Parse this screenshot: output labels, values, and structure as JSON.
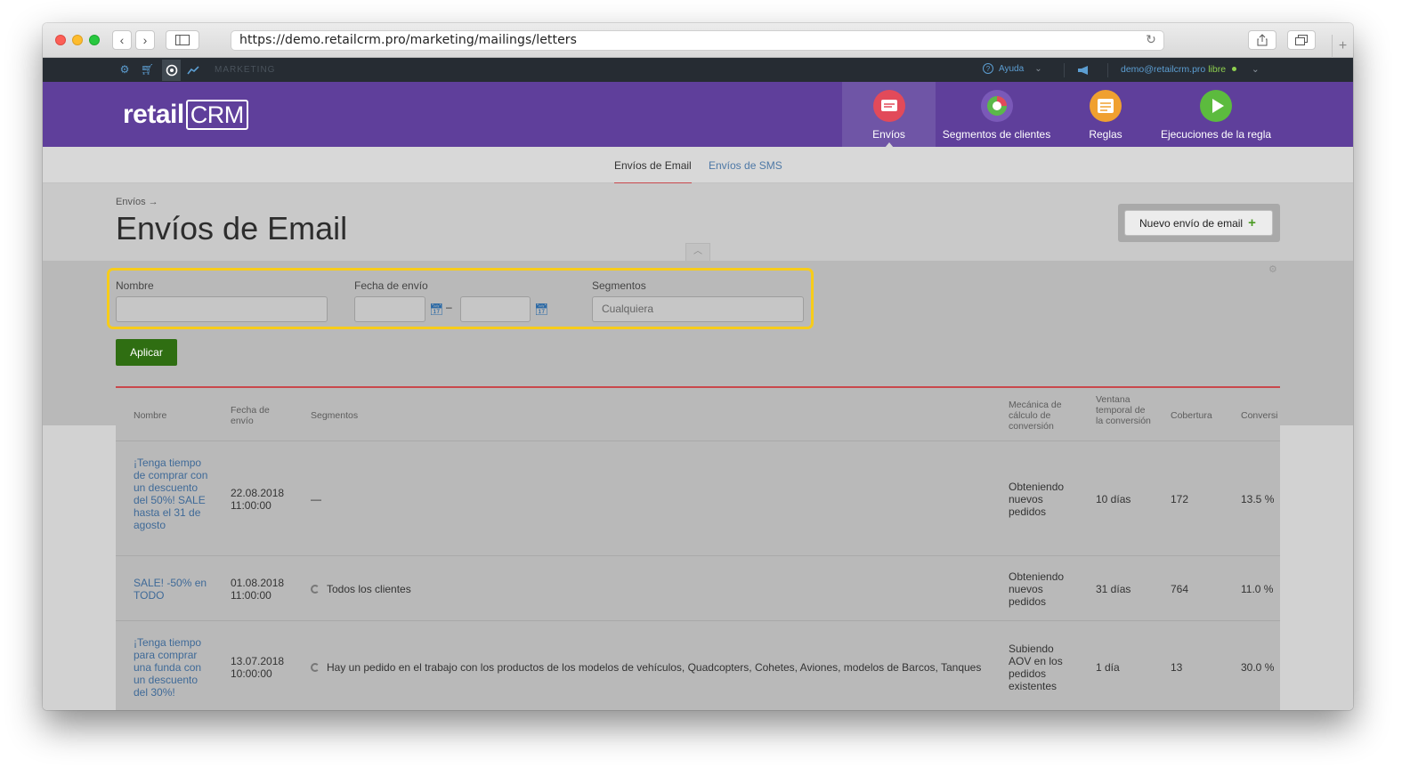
{
  "browser": {
    "url": "https://demo.retailcrm.pro/marketing/mailings/letters",
    "back_icon": "‹",
    "forward_icon": "›",
    "reload_icon": "↻",
    "new_tab": "+"
  },
  "topbar": {
    "section": "MARKETING",
    "help": "Ayuda",
    "user_email": "demo@retailcrm.pro",
    "user_plan": "libre"
  },
  "header": {
    "logo_text": "retail",
    "logo_mark": "CRM",
    "nav": [
      {
        "label": "Envíos",
        "icon": "envelope-icon",
        "color": "#e24a5a"
      },
      {
        "label": "Segmentos de clientes",
        "icon": "segments-icon",
        "color": "#7a59b8"
      },
      {
        "label": "Reglas",
        "icon": "rules-icon",
        "color": "#f0a030"
      },
      {
        "label": "Ejecuciones de la regla",
        "icon": "play-icon",
        "color": "#5cbb3e"
      }
    ]
  },
  "subnav": {
    "email_tab": "Envíos de Email",
    "sms_tab": "Envíos de SMS"
  },
  "page": {
    "breadcrumb": "Envíos →",
    "title": "Envíos de Email",
    "new_button": "Nuevo envío de email",
    "new_button_icon": "+"
  },
  "filters": {
    "name_label": "Nombre",
    "name_value": "",
    "date_label": "Fecha de envío",
    "date_from": "",
    "date_to": "",
    "date_sep": "–",
    "segments_label": "Segmentos",
    "segments_placeholder": "Cualquiera",
    "apply": "Aplicar"
  },
  "table": {
    "headers": {
      "name": "Nombre",
      "date": "Fecha de envío",
      "segments": "Segmentos",
      "mechanic": "Mecánica de cálculo de conversión",
      "window": "Ventana temporal de la conversión",
      "coverage": "Cobertura",
      "conversion": "Conversi"
    },
    "rows": [
      {
        "name": "¡Tenga tiempo de comprar con un descuento del 50%! SALE hasta el 31 de agosto",
        "date": "22.08.2018",
        "time": "11:00:00",
        "segments": "—",
        "mechanic": "Obteniendo nuevos pedidos",
        "window": "10 días",
        "coverage": "172",
        "conversion": "13.5 %"
      },
      {
        "name": "SALE! -50% en TODO",
        "date": "01.08.2018",
        "time": "11:00:00",
        "segments": "Todos los clientes",
        "mechanic": "Obteniendo nuevos pedidos",
        "window": "31 días",
        "coverage": "764",
        "conversion": "11.0 %"
      },
      {
        "name": "¡Tenga tiempo para comprar una funda con un descuento del 30%!",
        "date": "13.07.2018",
        "time": "10:00:00",
        "segments": "Hay un pedido en el trabajo con los productos de los modelos de vehículos, Quadcopters, Cohetes, Aviones, modelos de Barcos, Tanques",
        "mechanic": "Subiendo AOV en los pedidos existentes",
        "window": "1 día",
        "coverage": "13",
        "conversion": "30.0 %"
      }
    ]
  }
}
